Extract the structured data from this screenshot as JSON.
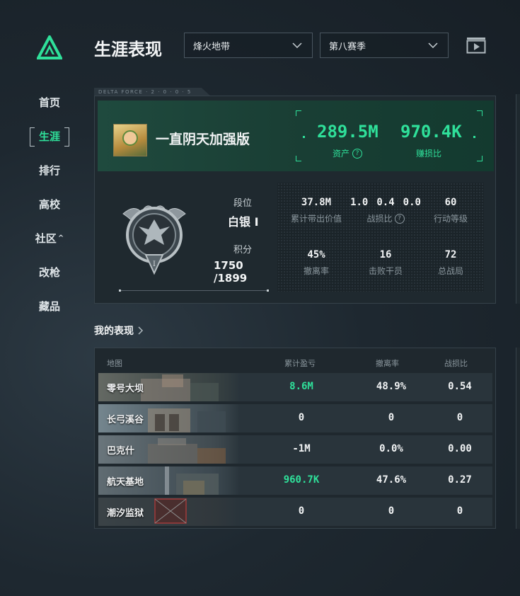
{
  "nav": {
    "items": [
      {
        "label": "首页"
      },
      {
        "label": "生涯"
      },
      {
        "label": "排行"
      },
      {
        "label": "高校"
      },
      {
        "label": "社区"
      },
      {
        "label": "改枪"
      },
      {
        "label": "藏品"
      }
    ]
  },
  "header": {
    "title": "生涯表现",
    "mode_select": "烽火地带",
    "season_select": "第八赛季"
  },
  "profile": {
    "tagline": "DELTA FORCE · 2 · 0 · 0 · 5",
    "username": "一直阴天加强版",
    "assets_value": "289.5M",
    "assets_label": "资产",
    "earn_ratio_value": "970.4K",
    "earn_ratio_label": "赚损比",
    "rank_label": "段位",
    "rank_value": "白银 I",
    "score_label": "积分",
    "score_value": "1750 /1899"
  },
  "stats": {
    "carry_out_value": "37.8M",
    "carry_out_label": "累计带出价值",
    "kd_values": [
      "1.0",
      "0.4",
      "0.0"
    ],
    "kd_label": "战损比",
    "action_level_value": "60",
    "action_level_label": "行动等级",
    "extract_rate_value": "45%",
    "extract_rate_label": "撤离率",
    "kills_value": "16",
    "kills_label": "击败干员",
    "total_matches_value": "72",
    "total_matches_label": "总战局"
  },
  "performance": {
    "title": "我的表现",
    "columns": [
      "地图",
      "累计盈亏",
      "撤离率",
      "战损比"
    ],
    "rows": [
      {
        "map": "零号大坝",
        "profit": "8.6M",
        "extract": "48.9%",
        "kd": "0.54"
      },
      {
        "map": "长弓溪谷",
        "profit": "0",
        "extract": "0",
        "kd": "0"
      },
      {
        "map": "巴克什",
        "profit": "-1M",
        "extract": "0.0%",
        "kd": "0.00"
      },
      {
        "map": "航天基地",
        "profit": "960.7K",
        "extract": "47.6%",
        "kd": "0.27"
      },
      {
        "map": "潮汐监狱",
        "profit": "0",
        "extract": "0",
        "kd": "0"
      }
    ]
  },
  "colors": {
    "accent": "#2fe09a",
    "background": "#1e2830"
  },
  "icons": {
    "logo": "delta-force-logo-icon",
    "play": "play-video-icon",
    "help": "question-icon"
  }
}
